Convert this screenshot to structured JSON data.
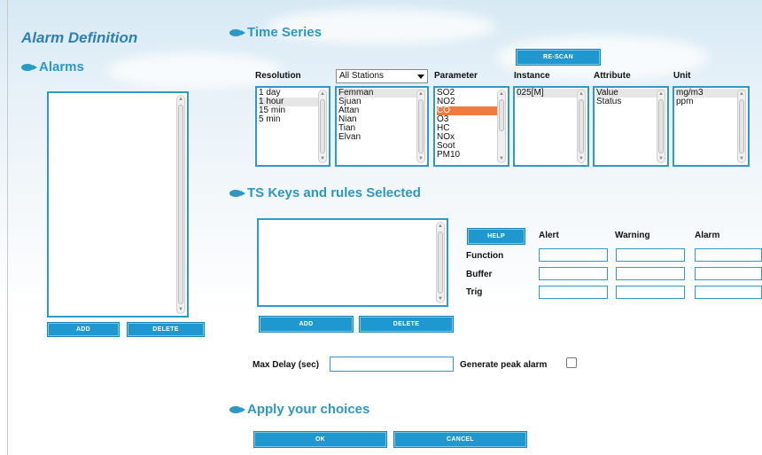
{
  "page_title": "Alarm Definition",
  "alarms": {
    "section_title": "Alarms",
    "add_label": "ADD",
    "delete_label": "DELETE"
  },
  "time_series": {
    "section_title": "Time Series",
    "rescan_label": "RE-SCAN",
    "headers": {
      "resolution": "Resolution",
      "parameter": "Parameter",
      "instance": "Instance",
      "attribute": "Attribute",
      "unit": "Unit"
    },
    "station_select": "All Stations",
    "resolution_items": [
      "1 day",
      "1 hour",
      "15 min",
      "5 min"
    ],
    "station_items": [
      "Femman",
      "Sjuan",
      "Attan",
      "Nian",
      "Tian",
      "Elvan"
    ],
    "parameter_items": [
      "SO2",
      "NO2",
      "CO",
      "O3",
      "HC",
      "NOx",
      "Soot",
      "PM10"
    ],
    "instance_items": [
      "025[M]"
    ],
    "attribute_items": [
      "Value",
      "Status"
    ],
    "unit_items": [
      "mg/m3",
      "ppm"
    ]
  },
  "ts_keys": {
    "section_title": "TS Keys and rules Selected",
    "add_label": "ADD",
    "delete_label": "DELETE",
    "help_label": "HELP",
    "columns": [
      "Alert",
      "Warning",
      "Alarm"
    ],
    "rows": [
      "Function",
      "Buffer",
      "Trig"
    ],
    "max_delay_label": "Max Delay (sec)",
    "generate_peak_label": "Generate peak alarm"
  },
  "apply": {
    "section_title": "Apply your choices",
    "ok_label": "OK",
    "cancel_label": "CANCEL"
  },
  "colors": {
    "accent": "#2c98c4",
    "button": "#1f97cf",
    "highlight": "#f07a3f"
  }
}
